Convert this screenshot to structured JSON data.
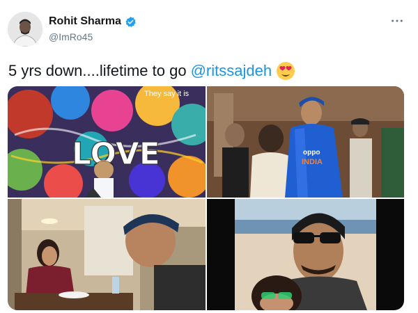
{
  "author": {
    "display_name": "Rohit Sharma",
    "handle": "@ImRo45",
    "verified": true
  },
  "tweet": {
    "text_main": "5 yrs down....lifetime to go",
    "mention": "@ritssajdeh",
    "emoji": "heart-eyes-emoji"
  },
  "media": {
    "photo_count": 4,
    "photo_1_graffiti": "LOVE",
    "photo_1_graffiti_top": "They say it is",
    "photo_2_jersey_text": "INDIA"
  },
  "colors": {
    "accent": "#1b95e0",
    "text": "#14171a",
    "secondary_text": "#657786"
  }
}
